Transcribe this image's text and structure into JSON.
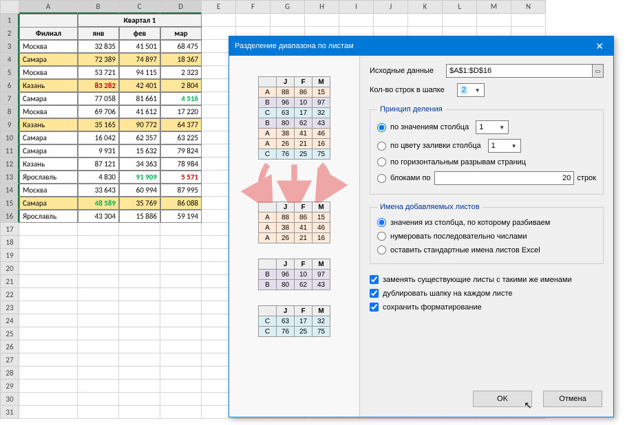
{
  "columns": [
    "A",
    "B",
    "C",
    "D",
    "E",
    "F",
    "G",
    "H",
    "I",
    "J",
    "K",
    "L",
    "M",
    "N"
  ],
  "rowcount": 31,
  "header": {
    "branch": "Филиал",
    "quarter": "Квартал 1",
    "months": [
      "янв",
      "фев",
      "мар"
    ]
  },
  "data": [
    {
      "name": "Москва",
      "v": [
        "32 835",
        "41 501",
        "68 475"
      ],
      "hl": false,
      "styles": [
        "",
        "",
        ""
      ]
    },
    {
      "name": "Самара",
      "v": [
        "72 389",
        "74 897",
        "18 367"
      ],
      "hl": true,
      "styles": [
        "",
        "",
        ""
      ]
    },
    {
      "name": "Москва",
      "v": [
        "53 721",
        "94 115",
        "2 323"
      ],
      "hl": false,
      "styles": [
        "",
        "",
        ""
      ]
    },
    {
      "name": "Казань",
      "v": [
        "83 282",
        "42 401",
        "2 804"
      ],
      "hl": true,
      "styles": [
        "red",
        "",
        ""
      ]
    },
    {
      "name": "Самара",
      "v": [
        "77 058",
        "81 661",
        "4 516"
      ],
      "hl": false,
      "styles": [
        "",
        "",
        "green"
      ]
    },
    {
      "name": "Москва",
      "v": [
        "69 706",
        "41 612",
        "17 220"
      ],
      "hl": false,
      "styles": [
        "",
        "",
        ""
      ]
    },
    {
      "name": "Казань",
      "v": [
        "35 165",
        "90 772",
        "64 377"
      ],
      "hl": true,
      "styles": [
        "",
        "",
        ""
      ]
    },
    {
      "name": "Самара",
      "v": [
        "16 042",
        "62 357",
        "63 225"
      ],
      "hl": false,
      "styles": [
        "",
        "",
        ""
      ]
    },
    {
      "name": "Самара",
      "v": [
        "9 931",
        "15 632",
        "79 824"
      ],
      "hl": false,
      "styles": [
        "",
        "",
        ""
      ]
    },
    {
      "name": "Казань",
      "v": [
        "87 121",
        "34 363",
        "78 984"
      ],
      "hl": false,
      "styles": [
        "",
        "",
        ""
      ]
    },
    {
      "name": "Ярославль",
      "v": [
        "4 830",
        "91 909",
        "5 571"
      ],
      "hl": false,
      "styles": [
        "",
        "green",
        "red"
      ]
    },
    {
      "name": "Москва",
      "v": [
        "33 643",
        "60 994",
        "87 995"
      ],
      "hl": false,
      "styles": [
        "",
        "",
        ""
      ]
    },
    {
      "name": "Самара",
      "v": [
        "48 589",
        "35 769",
        "86 088"
      ],
      "hl": true,
      "styles": [
        "green",
        "",
        ""
      ]
    },
    {
      "name": "Ярославль",
      "v": [
        "43 304",
        "15 886",
        "59 194"
      ],
      "hl": false,
      "styles": [
        "",
        "",
        ""
      ]
    }
  ],
  "dialog": {
    "title": "Разделение диапазона по листам",
    "source_label": "Исходные данные",
    "source_value": "$A$1:$D$16",
    "header_rows_label": "Кол-во строк в шапке",
    "header_rows_value": "2",
    "principle_legend": "Принцип деления",
    "opt_by_column": "по значениям столбца",
    "opt_by_column_val": "1",
    "opt_by_color": "по цвету заливки столбца",
    "opt_by_color_val": "1",
    "opt_by_hbreak": "по горизонтальным разрывам страниц",
    "opt_by_blocks": "блоками по",
    "opt_by_blocks_val": "20",
    "opt_by_blocks_suffix": "строк",
    "names_legend": "Имена добавляемых листов",
    "name_opt1": "значения из столбца, по которому разбиваем",
    "name_opt2": "нумеровать последовательно числами",
    "name_opt3": "оставить стандартные имена листов Excel",
    "chk_replace": "заменять существующие листы с такими же именами",
    "chk_dup_header": "дублировать шапку на каждом листе",
    "chk_keep_fmt": "сохранить форматирование",
    "btn_ok": "OK",
    "btn_cancel": "Отмена"
  },
  "preview": {
    "hdr": [
      "J",
      "F",
      "M"
    ],
    "all": [
      {
        "k": "A",
        "cls": "mini-a",
        "v": [
          88,
          86,
          15
        ]
      },
      {
        "k": "B",
        "cls": "mini-b",
        "v": [
          96,
          10,
          97
        ]
      },
      {
        "k": "C",
        "cls": "mini-c",
        "v": [
          63,
          17,
          32
        ]
      },
      {
        "k": "B",
        "cls": "mini-b",
        "v": [
          80,
          62,
          43
        ]
      },
      {
        "k": "A",
        "cls": "mini-a",
        "v": [
          38,
          41,
          46
        ]
      },
      {
        "k": "A",
        "cls": "mini-a",
        "v": [
          26,
          21,
          16
        ]
      },
      {
        "k": "C",
        "cls": "mini-c",
        "v": [
          76,
          25,
          75
        ]
      }
    ],
    "groups": [
      [
        {
          "k": "A",
          "cls": "mini-a",
          "v": [
            88,
            86,
            15
          ]
        },
        {
          "k": "A",
          "cls": "mini-a",
          "v": [
            38,
            41,
            46
          ]
        },
        {
          "k": "A",
          "cls": "mini-a",
          "v": [
            26,
            21,
            16
          ]
        }
      ],
      [
        {
          "k": "B",
          "cls": "mini-b",
          "v": [
            96,
            10,
            97
          ]
        },
        {
          "k": "B",
          "cls": "mini-b",
          "v": [
            80,
            62,
            43
          ]
        }
      ],
      [
        {
          "k": "C",
          "cls": "mini-c",
          "v": [
            63,
            17,
            32
          ]
        },
        {
          "k": "C",
          "cls": "mini-c",
          "v": [
            76,
            25,
            75
          ]
        }
      ]
    ]
  }
}
